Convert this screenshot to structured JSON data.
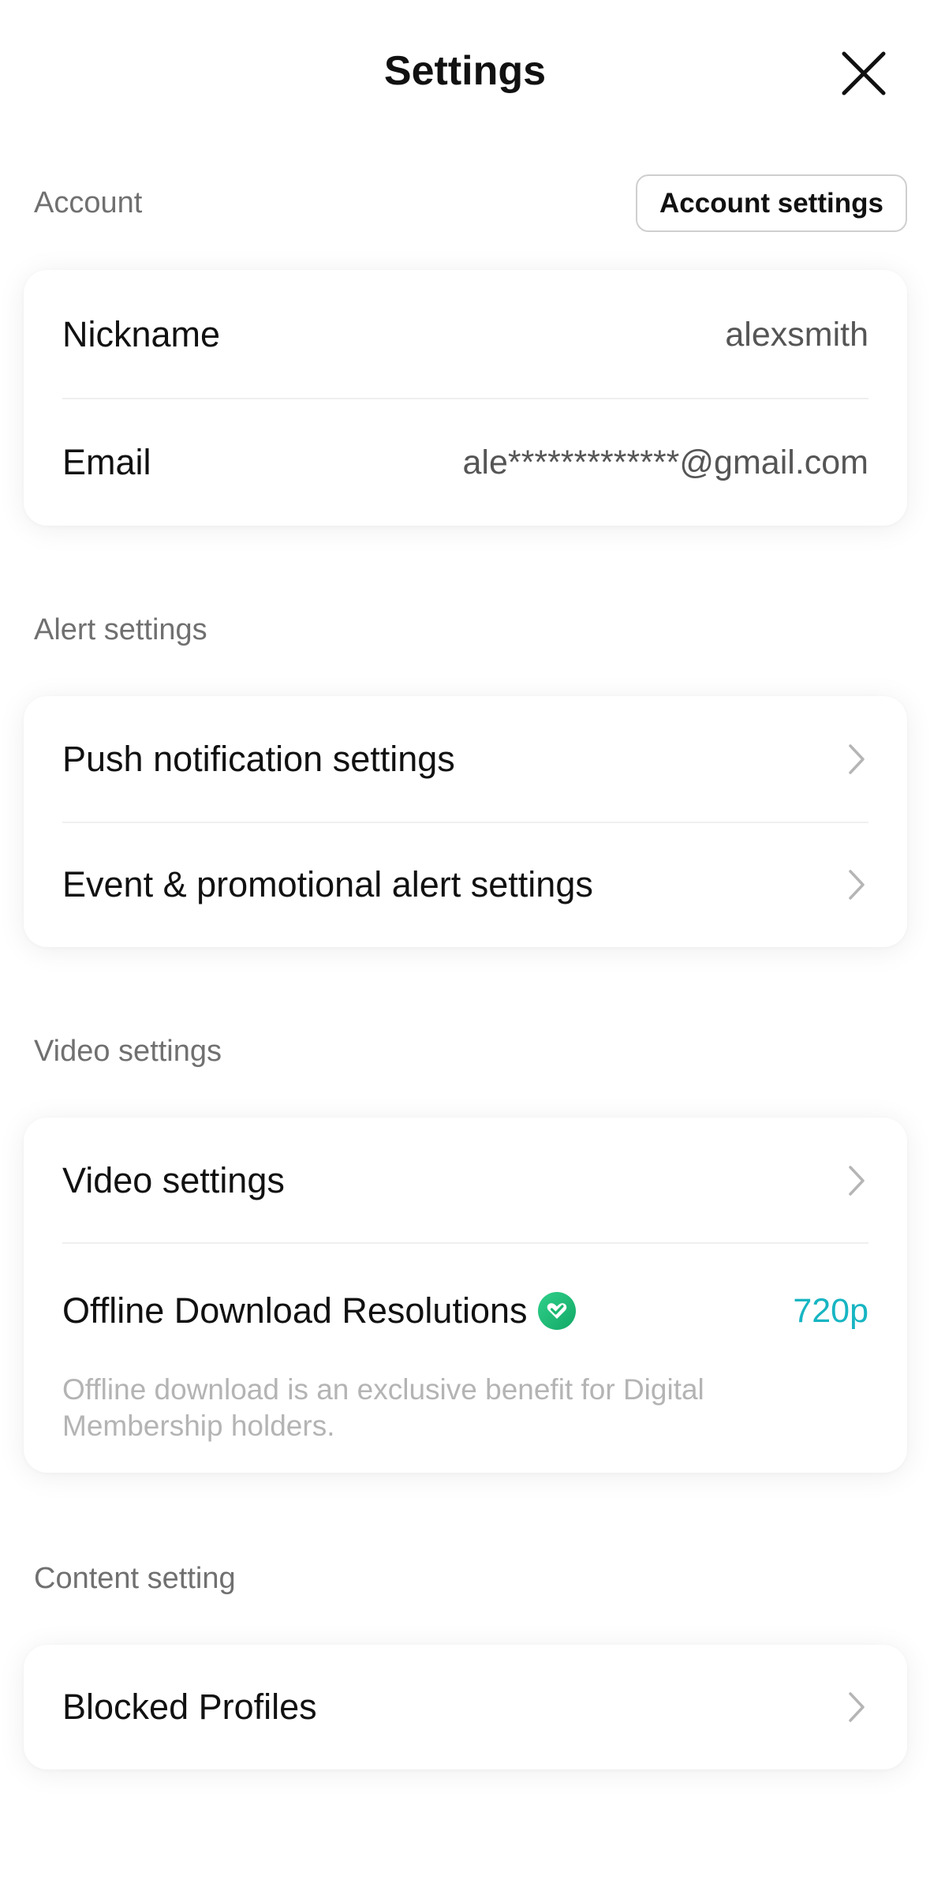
{
  "header": {
    "title": "Settings",
    "close_icon": "close-icon"
  },
  "account": {
    "section_label": "Account",
    "settings_button": "Account settings",
    "nickname_label": "Nickname",
    "nickname_value": "alexsmith",
    "email_label": "Email",
    "email_value": "ale*************@gmail.com"
  },
  "alerts": {
    "section_label": "Alert settings",
    "items": [
      {
        "label": "Push notification settings",
        "icon": "chevron-right-icon"
      },
      {
        "label": "Event & promotional alert settings",
        "icon": "chevron-right-icon"
      }
    ]
  },
  "video": {
    "section_label": "Video settings",
    "video_settings_label": "Video settings",
    "offline_label": "Offline Download Resolutions",
    "offline_badge_icon": "membership-badge-icon",
    "offline_value": "720p",
    "offline_note": "Offline download is an exclusive benefit for Digital Membership holders.",
    "accent_color": "#17b5c2",
    "badge_color": "#22c27a"
  },
  "content": {
    "section_label": "Content setting",
    "blocked_label": "Blocked Profiles",
    "icon": "chevron-right-icon"
  }
}
